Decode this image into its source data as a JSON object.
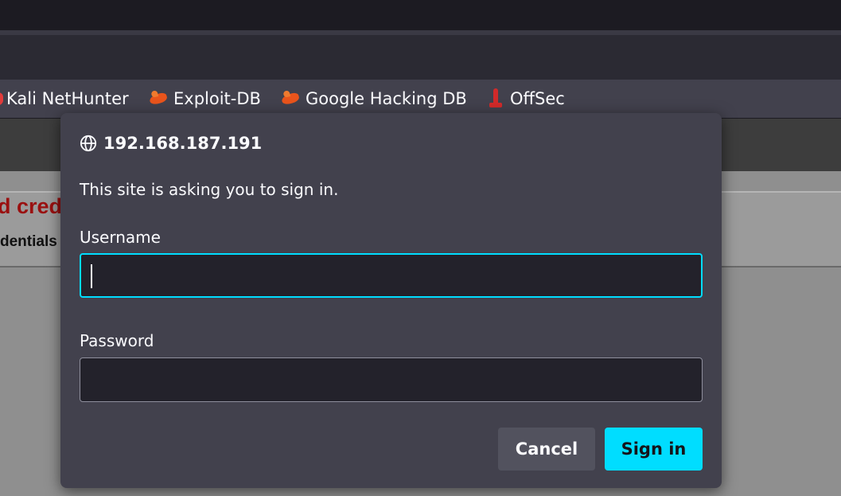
{
  "bookmarks": [
    {
      "label": "Kali NetHunter",
      "icon": "kali-icon"
    },
    {
      "label": "Exploit-DB",
      "icon": "exploit-db-icon"
    },
    {
      "label": "Google Hacking DB",
      "icon": "exploit-db-icon"
    },
    {
      "label": "OffSec",
      "icon": "offsec-icon"
    }
  ],
  "background_page": {
    "heading_fragment": "d cred",
    "subtext_fragment": "dentials"
  },
  "dialog": {
    "origin": "192.168.187.191",
    "message": "This site is asking you to sign in.",
    "username_label": "Username",
    "username_value": "",
    "password_label": "Password",
    "password_value": "",
    "cancel_label": "Cancel",
    "signin_label": "Sign in"
  },
  "colors": {
    "accent": "#00ddff",
    "dialog_bg": "#42414d",
    "field_bg": "#23222b",
    "heading_red": "#9a1010"
  }
}
